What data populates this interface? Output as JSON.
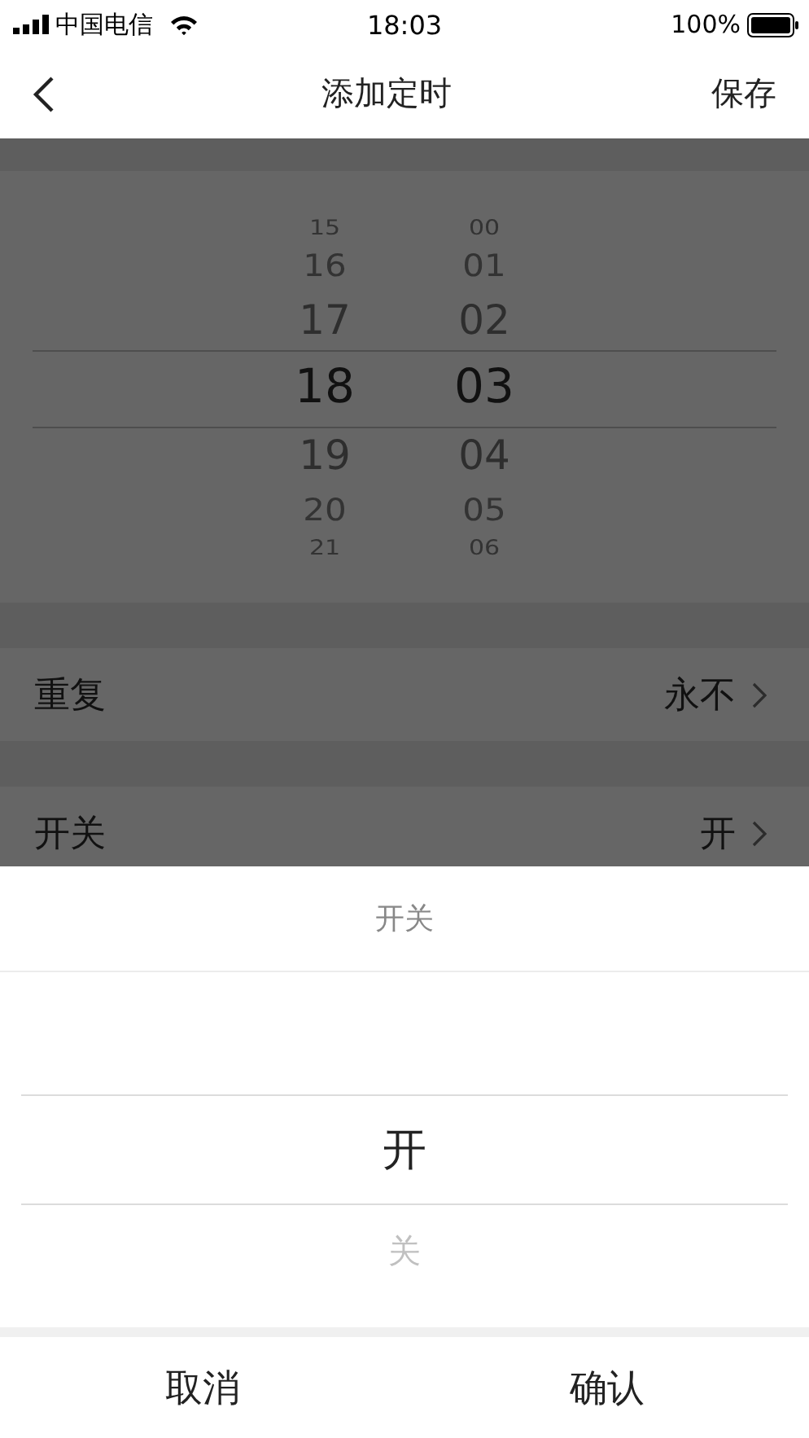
{
  "status_bar": {
    "carrier": "中国电信",
    "time": "18:03",
    "battery": "100%"
  },
  "nav": {
    "title": "添加定时",
    "action": "保存"
  },
  "time_picker": {
    "hours": [
      {
        "label": "15",
        "selected": false
      },
      {
        "label": "16",
        "selected": false
      },
      {
        "label": "17",
        "selected": false
      },
      {
        "label": "18",
        "selected": true
      },
      {
        "label": "19",
        "selected": false
      },
      {
        "label": "20",
        "selected": false
      },
      {
        "label": "21",
        "selected": false
      }
    ],
    "minutes": [
      {
        "label": "00",
        "selected": false
      },
      {
        "label": "01",
        "selected": false
      },
      {
        "label": "02",
        "selected": false
      },
      {
        "label": "03",
        "selected": true
      },
      {
        "label": "04",
        "selected": false
      },
      {
        "label": "05",
        "selected": false
      },
      {
        "label": "06",
        "selected": false
      }
    ]
  },
  "settings": [
    {
      "label": "重复",
      "value": "永不"
    },
    {
      "label": "开关",
      "value": "开"
    }
  ],
  "sheet": {
    "title": "开关",
    "options": [
      {
        "label": "开",
        "selected": true
      },
      {
        "label": "关",
        "selected": false
      }
    ],
    "buttons": [
      "取消",
      "确认"
    ]
  }
}
